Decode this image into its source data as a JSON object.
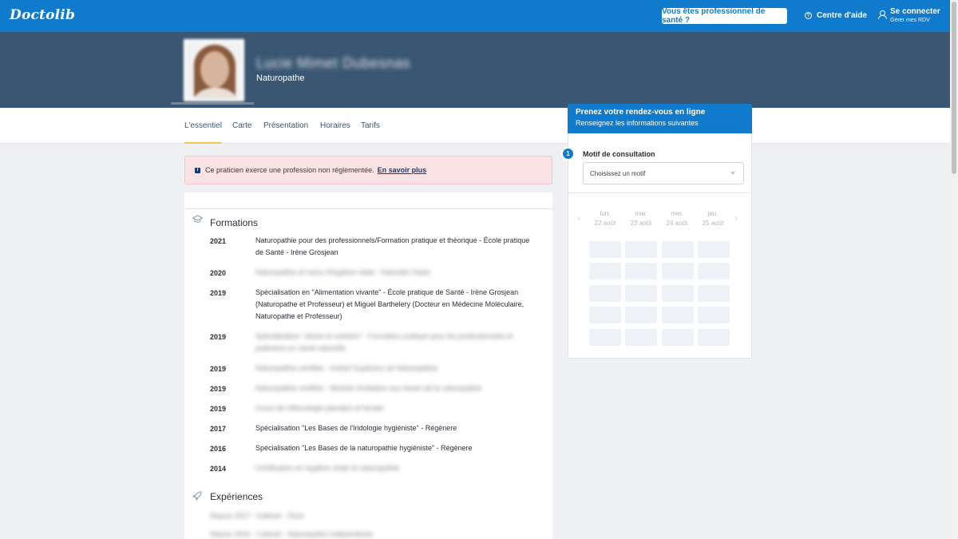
{
  "topbar": {
    "logo": "Doctolib",
    "pro_button": "Vous êtes professionnel de santé ?",
    "help_label": "Centre d'aide",
    "login_label": "Se connecter",
    "login_sub": "Gérer mes RDV"
  },
  "profile": {
    "name": "Lucie Mimet Dubesnas",
    "specialty": "Naturopathe"
  },
  "tabs": [
    "L'essentiel",
    "Carte",
    "Présentation",
    "Horaires",
    "Tarifs"
  ],
  "alert": {
    "text": "Ce praticien exerce une profession non réglementée.",
    "link": "En savoir plus"
  },
  "formations": {
    "title": "Formations",
    "items": [
      {
        "year": "2021",
        "text": "Naturopathie pour des professionnels/Formation pratique et théorique - École pratique de Santé - Irène Grosjean",
        "blurred": false
      },
      {
        "year": "2020",
        "text": "Naturopathie et soins d'hygiène vitale - Naturalis Vitalis",
        "blurred": true
      },
      {
        "year": "2019",
        "text": "Spécialisation en \"Alimentation vivante\" - École pratique de Santé - Irène Grosjean (Naturopathe et Professeur) et Miguel Barthelery (Docteur en Médecine Moléculaire, Naturopathe et Professeur)",
        "blurred": false
      },
      {
        "year": "2019",
        "text": "Spécialisation \"Jeûne et nutrition\" - Formation pratique pour les professionnels et praticiens en santé naturelle",
        "blurred": true
      },
      {
        "year": "2019",
        "text": "Naturopathie certifiée - Institut Supérieur de Naturopathie",
        "blurred": true
      },
      {
        "year": "2019",
        "text": "Naturopathie certifiée - Module d'initiation aux bases de la naturopathie",
        "blurred": true
      },
      {
        "year": "2019",
        "text": "Cours de réflexologie plantaire et faciale",
        "blurred": true
      },
      {
        "year": "2017",
        "text": "Spécialisation \"Les Bases de l'Iridologie hygiéniste\" - Régènere",
        "blurred": false
      },
      {
        "year": "2016",
        "text": "Spécialisation \"Les Bases de la naturopathie hygiéniste\" - Régènere",
        "blurred": false
      },
      {
        "year": "2014",
        "text": "Certification en hygiène vitale et naturopathie",
        "blurred": true
      }
    ]
  },
  "experiences": {
    "title": "Expériences",
    "items": [
      {
        "text": "Depuis 2017 - Cabinet - Paris",
        "blurred": true
      },
      {
        "text": "Depuis 2016 - Cabinet - Naturopathe indépendante",
        "blurred": true
      }
    ]
  },
  "booking": {
    "title": "Prenez votre rendez-vous en ligne",
    "subtitle": "Renseignez les informations suivantes",
    "step_number": "1",
    "motif_label": "Motif de consultation",
    "select_placeholder": "Choisissez un motif",
    "days": [
      {
        "day": "lun.",
        "date": "22 août"
      },
      {
        "day": "mar.",
        "date": "23 août"
      },
      {
        "day": "mer.",
        "date": "24 août"
      },
      {
        "day": "jeu.",
        "date": "25 août"
      }
    ]
  },
  "colors": {
    "brand": "#107acc",
    "header": "#3a5673",
    "alert_bg": "#fbe3e5",
    "tab_underline": "#f2c94c"
  }
}
